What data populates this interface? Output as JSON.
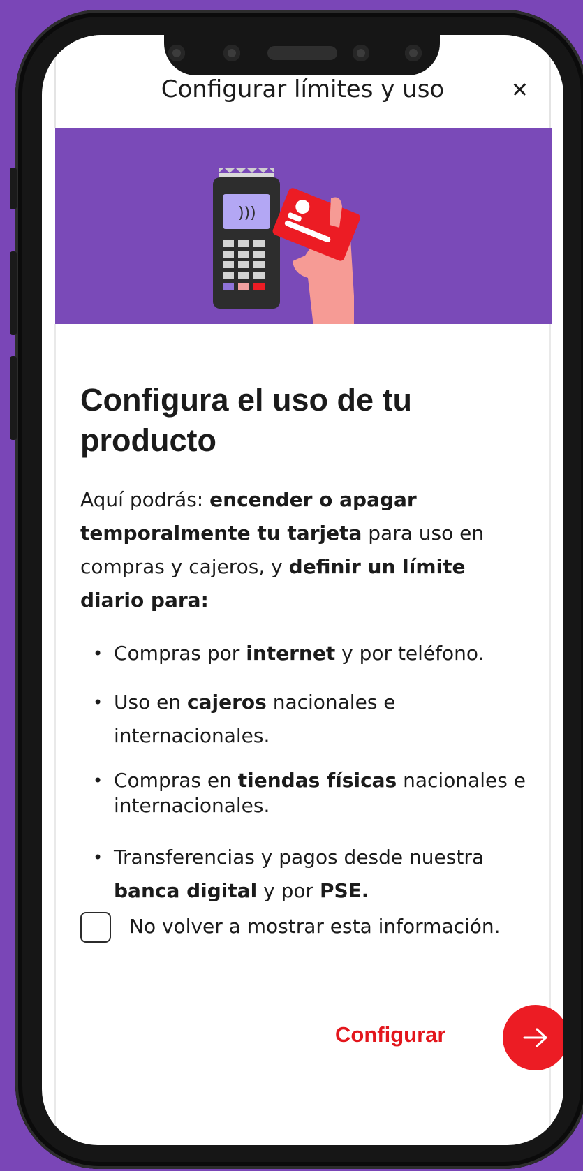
{
  "header": {
    "title": "Configurar límites y uso",
    "close_glyph": "✕"
  },
  "hero": {
    "illustration": "payment-terminal-with-card",
    "colors": {
      "background": "#7a4ab8",
      "card": "#ec1c24",
      "terminal": "#2d2d2d",
      "hand": "#f69b95"
    }
  },
  "main": {
    "title": "Configura el uso de tu producto",
    "intro": {
      "p1": "Aquí podrás: ",
      "b1": "encender o apagar temporalmente tu tarjeta",
      "p2": " para uso en compras y cajeros, y ",
      "b2": "definir un límite diario para:"
    },
    "bullets": [
      {
        "pre": "Compras por ",
        "bold": "internet",
        "post": " y por teléfono."
      },
      {
        "pre": "Uso en ",
        "bold": "cajeros",
        "post": " nacionales e internacionales."
      },
      {
        "pre": "Compras en ",
        "bold": "tiendas físicas",
        "post": " nacionales e internacionales."
      },
      {
        "pre": "Transferencias y pagos desde nuestra ",
        "bold": "banca digital",
        "mid": " y por ",
        "bold2": "PSE."
      }
    ],
    "checkbox": {
      "label": "No volver a mostrar esta información.",
      "checked": false
    },
    "cta": {
      "label": "Configurar",
      "icon": "arrow-right-icon"
    }
  },
  "colors": {
    "page_background": "#7a46b7",
    "accent": "#ec1c24",
    "text": "#1b1b1b"
  }
}
